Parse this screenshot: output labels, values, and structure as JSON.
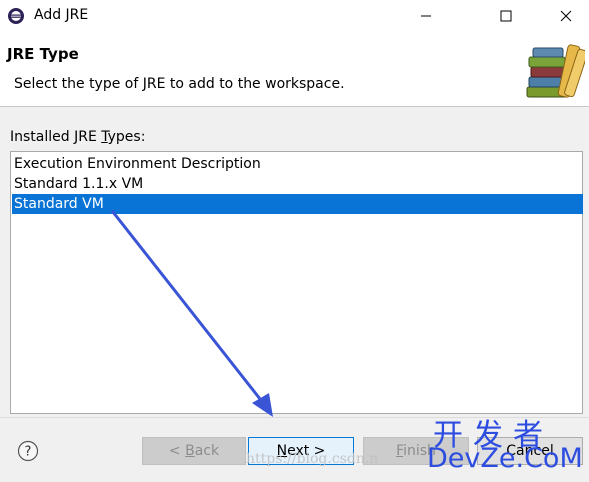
{
  "window": {
    "title": "Add JRE"
  },
  "header": {
    "title": "JRE Type",
    "description": "Select the type of JRE to add to the workspace."
  },
  "types": {
    "label_prefix": "Installed JRE ",
    "label_mnemonic": "T",
    "label_suffix": "ypes:",
    "items": [
      {
        "label": "Execution Environment Description",
        "selected": false
      },
      {
        "label": "Standard 1.1.x VM",
        "selected": false
      },
      {
        "label": "Standard VM",
        "selected": true
      }
    ]
  },
  "footer": {
    "help_icon": "question-icon",
    "back": {
      "prefix": "< ",
      "mnemonic": "B",
      "rest": "ack",
      "enabled": false
    },
    "next": {
      "mnemonic": "N",
      "rest": "ext >",
      "enabled": true,
      "default": true
    },
    "finish": {
      "mnemonic": "F",
      "rest": "inish",
      "enabled": false
    },
    "cancel": {
      "label": "Cancel",
      "enabled": true
    }
  },
  "watermark": {
    "url": "https://blog.csdn.n",
    "brand_cn": "开发者",
    "brand_en": "DevZe.CoM"
  },
  "colors": {
    "selection": "#0a74d6",
    "annotation_arrow": "#3a54d6",
    "watermark_brand": "#2c4de0"
  }
}
